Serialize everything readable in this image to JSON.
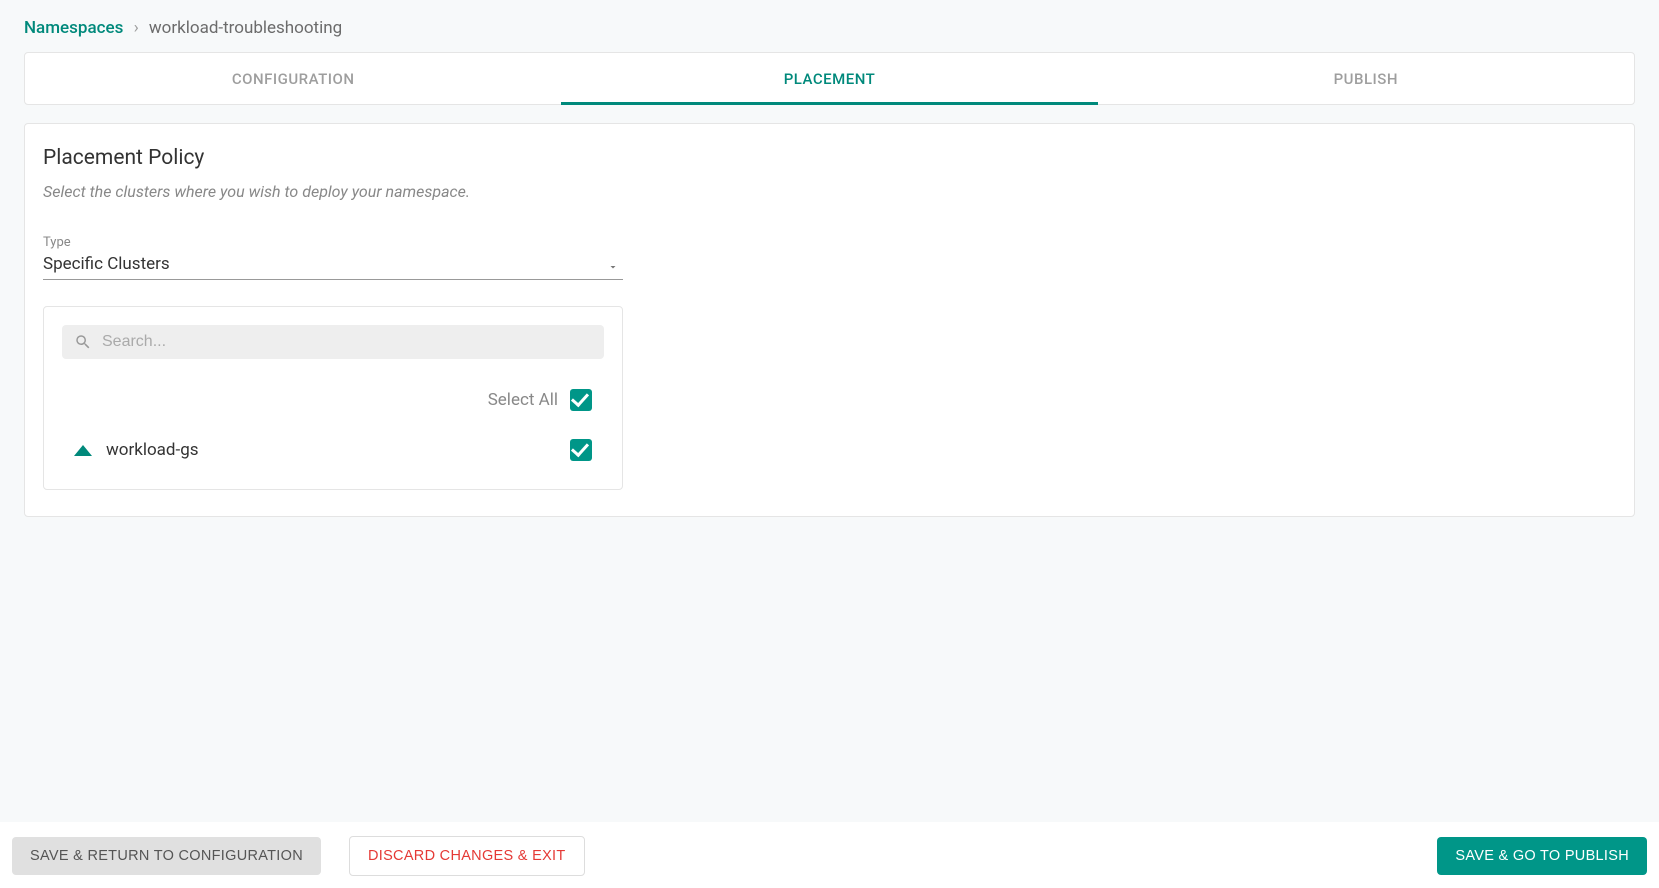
{
  "breadcrumb": {
    "root": "Namespaces",
    "separator": "›",
    "current": "workload-troubleshooting"
  },
  "tabs": {
    "configuration": "CONFIGURATION",
    "placement": "PLACEMENT",
    "publish": "PUBLISH"
  },
  "panel": {
    "title": "Placement Policy",
    "description": "Select the clusters where you wish to deploy your namespace."
  },
  "typeField": {
    "label": "Type",
    "value": "Specific Clusters"
  },
  "search": {
    "placeholder": "Search..."
  },
  "selectAll": {
    "label": "Select All"
  },
  "clusters": [
    {
      "name": "workload-gs"
    }
  ],
  "footer": {
    "back": "SAVE & RETURN TO CONFIGURATION",
    "discard": "DISCARD CHANGES & EXIT",
    "next": "SAVE & GO TO PUBLISH"
  }
}
